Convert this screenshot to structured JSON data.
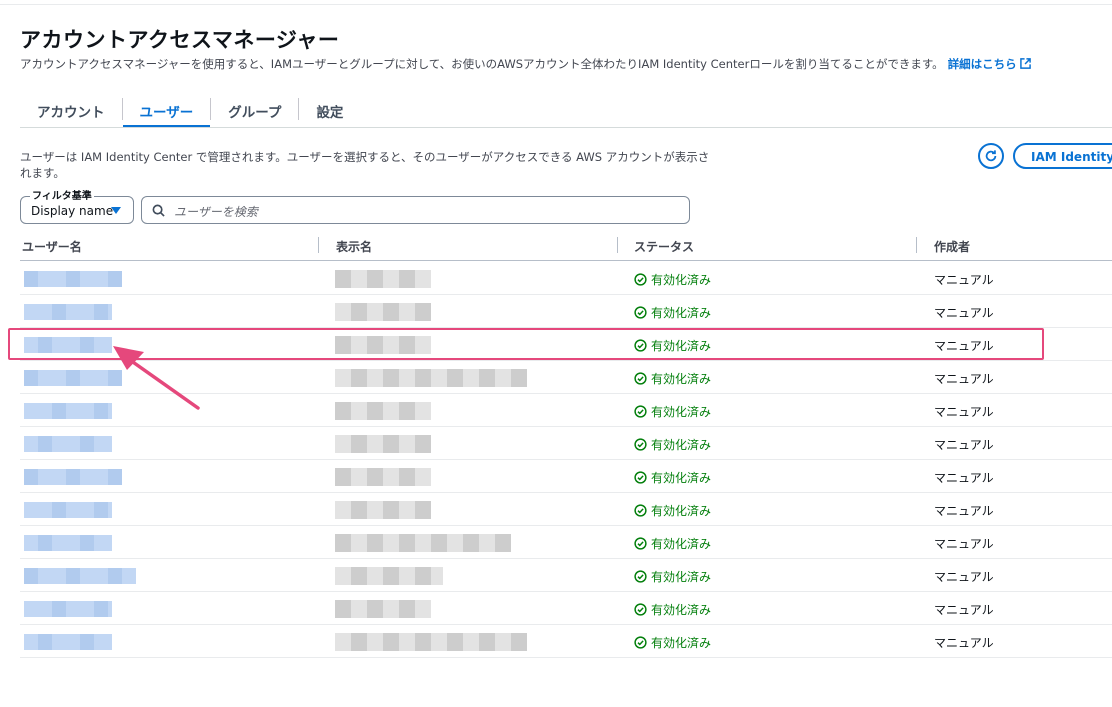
{
  "page": {
    "title": "アカウントアクセスマネージャー",
    "description": "アカウントアクセスマネージャーを使用すると、IAMユーザーとグループに対して、お使いのAWSアカウント全体わたりIAM Identity Centerロールを割り当てることができます。",
    "learn_more": "詳細はこちら"
  },
  "tabs": [
    {
      "label": "アカウント",
      "active": false
    },
    {
      "label": "ユーザー",
      "active": true
    },
    {
      "label": "グループ",
      "active": false
    },
    {
      "label": "設定",
      "active": false
    }
  ],
  "info_text": "ユーザーは IAM Identity Center で管理されます。ユーザーを選択すると、そのユーザーがアクセスできる AWS アカウントが表示されます。",
  "iam_button": "IAM Identity Center",
  "filter": {
    "label": "フィルタ基準",
    "selected": "Display name",
    "search_placeholder": "ユーザーを検索"
  },
  "table": {
    "columns": [
      "ユーザー名",
      "表示名",
      "ステータス",
      "作成者"
    ],
    "rows": [
      {
        "status": "有効化済み",
        "creator": "マニュアル"
      },
      {
        "status": "有効化済み",
        "creator": "マニュアル"
      },
      {
        "status": "有効化済み",
        "creator": "マニュアル"
      },
      {
        "status": "有効化済み",
        "creator": "マニュアル"
      },
      {
        "status": "有効化済み",
        "creator": "マニュアル"
      },
      {
        "status": "有効化済み",
        "creator": "マニュアル"
      },
      {
        "status": "有効化済み",
        "creator": "マニュアル"
      },
      {
        "status": "有効化済み",
        "creator": "マニュアル"
      },
      {
        "status": "有効化済み",
        "creator": "マニュアル"
      },
      {
        "status": "有効化済み",
        "creator": "マニュアル"
      },
      {
        "status": "有効化済み",
        "creator": "マニュアル"
      },
      {
        "status": "有効化済み",
        "creator": "マニュアル"
      }
    ]
  },
  "colors": {
    "accent": "#0972d3",
    "success": "#037f0c",
    "annotation": "#e5487c"
  }
}
